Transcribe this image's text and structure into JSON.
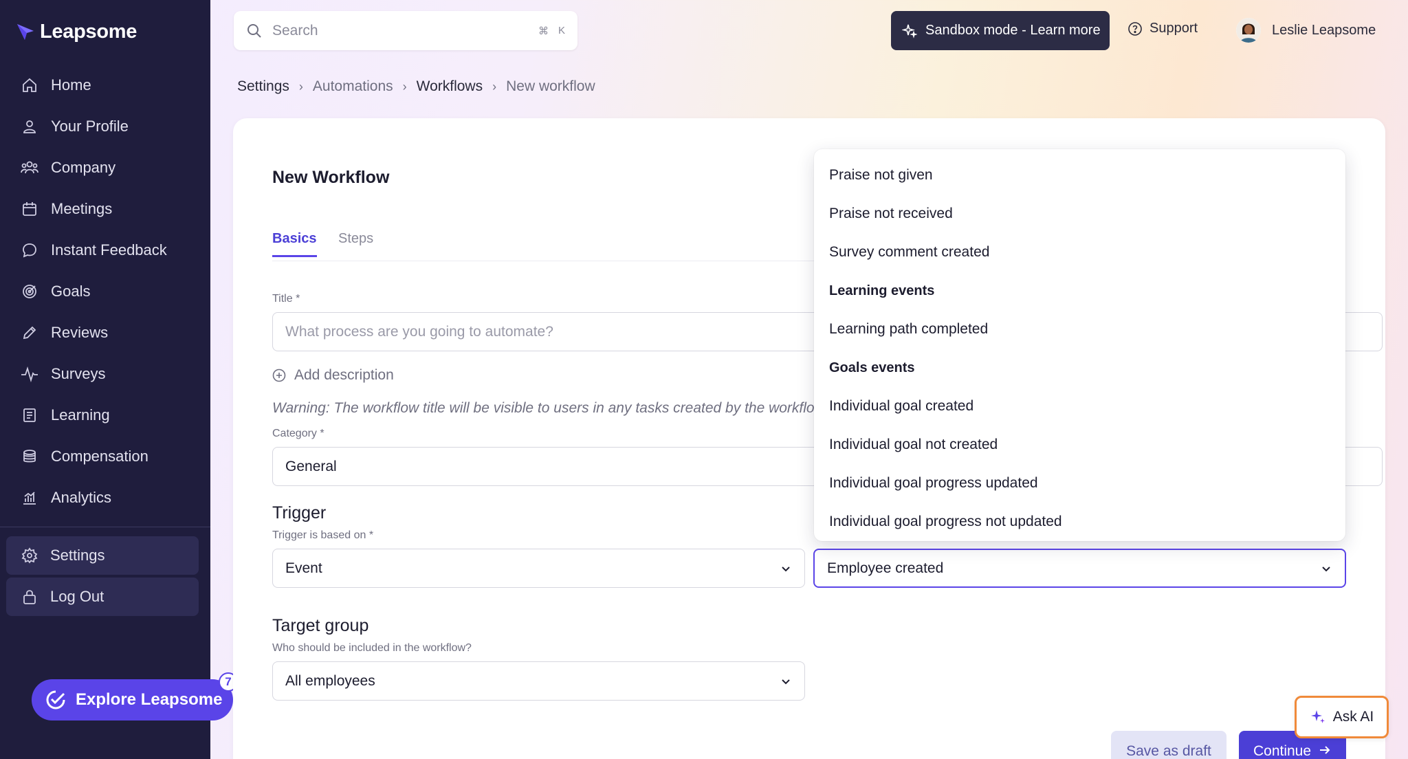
{
  "brand": {
    "name": "Leapsome"
  },
  "sidebar": {
    "items": [
      {
        "label": "Home",
        "icon": "home-icon"
      },
      {
        "label": "Your Profile",
        "icon": "user-icon"
      },
      {
        "label": "Company",
        "icon": "users-icon"
      },
      {
        "label": "Meetings",
        "icon": "calendar-icon"
      },
      {
        "label": "Instant Feedback",
        "icon": "chat-icon"
      },
      {
        "label": "Goals",
        "icon": "target-icon"
      },
      {
        "label": "Reviews",
        "icon": "pencil-icon"
      },
      {
        "label": "Surveys",
        "icon": "pulse-icon"
      },
      {
        "label": "Learning",
        "icon": "book-icon"
      },
      {
        "label": "Compensation",
        "icon": "coins-icon"
      },
      {
        "label": "Analytics",
        "icon": "chart-icon"
      }
    ],
    "settings_label": "Settings",
    "logout_label": "Log Out",
    "explore_label": "Explore Leapsome",
    "explore_badge": "7"
  },
  "topbar": {
    "search_placeholder": "Search",
    "shortcut_cmd": "⌘",
    "shortcut_key": "K",
    "sandbox_label": "Sandbox mode - Learn more",
    "support_label": "Support",
    "user_name": "Leslie Leapsome"
  },
  "breadcrumb": [
    "Settings",
    "Automations",
    "Workflows",
    "New workflow"
  ],
  "form": {
    "heading": "New Workflow",
    "tabs": [
      "Basics",
      "Steps"
    ],
    "title_label": "Title *",
    "title_placeholder": "What process are you going to automate?",
    "add_description": "Add description",
    "warning": "Warning: The workflow title will be visible to users in any tasks created by the workflow",
    "category_label": "Category *",
    "category_value": "General",
    "trigger_heading": "Trigger",
    "trigger_label": "Trigger is based on *",
    "trigger_value": "Event",
    "event_value": "Employee created",
    "target_heading": "Target group",
    "target_label": "Who should be included in the workflow?",
    "target_value": "All employees"
  },
  "dropdown": {
    "items": [
      {
        "type": "item",
        "label": "Praise not given"
      },
      {
        "type": "item",
        "label": "Praise not received"
      },
      {
        "type": "item",
        "label": "Survey comment created"
      },
      {
        "type": "group",
        "label": "Learning events"
      },
      {
        "type": "item",
        "label": "Learning path completed"
      },
      {
        "type": "group",
        "label": "Goals events"
      },
      {
        "type": "item",
        "label": "Individual goal created"
      },
      {
        "type": "item",
        "label": "Individual goal not created"
      },
      {
        "type": "item",
        "label": "Individual goal progress updated"
      },
      {
        "type": "item",
        "label": "Individual goal progress not updated"
      }
    ]
  },
  "actions": {
    "save_draft": "Save as draft",
    "continue": "Continue",
    "ask_ai": "Ask AI"
  },
  "colors": {
    "sidebar_bg": "#1f1d3d",
    "accent": "#5a44e8",
    "ask_ai_border": "#f08a3a"
  }
}
